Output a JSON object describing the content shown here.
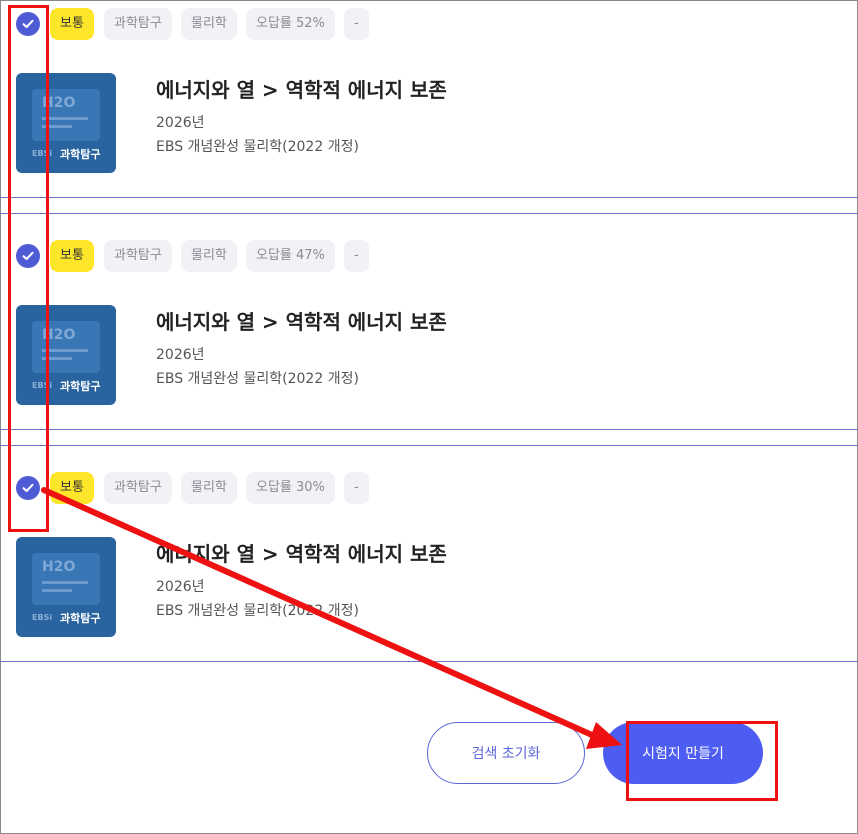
{
  "items": [
    {
      "checked": true,
      "tags": [
        "보통",
        "과학탐구",
        "물리학",
        "오답률 52%",
        "-"
      ],
      "title": "에너지와 열 > 역학적 에너지 보존",
      "year": "2026년",
      "book": "EBS 개념완성 물리학(2022 개정)",
      "thumb": {
        "h2o": "H2O",
        "ebs": "EBSi",
        "category": "과학탐구"
      }
    },
    {
      "checked": true,
      "tags": [
        "보통",
        "과학탐구",
        "물리학",
        "오답률 47%",
        "-"
      ],
      "title": "에너지와 열 > 역학적 에너지 보존",
      "year": "2026년",
      "book": "EBS 개념완성 물리학(2022 개정)",
      "thumb": {
        "h2o": "H2O",
        "ebs": "EBSi",
        "category": "과학탐구"
      }
    },
    {
      "checked": true,
      "tags": [
        "보통",
        "과학탐구",
        "물리학",
        "오답률 30%",
        "-"
      ],
      "title": "에너지와 열 > 역학적 에너지 보존",
      "year": "2026년",
      "book": "EBS 개념완성 물리학(2022 개정)",
      "thumb": {
        "h2o": "H2O",
        "ebs": "EBSi",
        "category": "과학탐구"
      }
    }
  ],
  "actions": {
    "reset_label": "검색 초기화",
    "make_label": "시험지 만들기"
  },
  "colors": {
    "accent": "#4d5df2",
    "check": "#4f5bd5",
    "level_tag": "#fde62a",
    "thumb_bg": "#2a64a0",
    "annotation": "#ee1111"
  }
}
